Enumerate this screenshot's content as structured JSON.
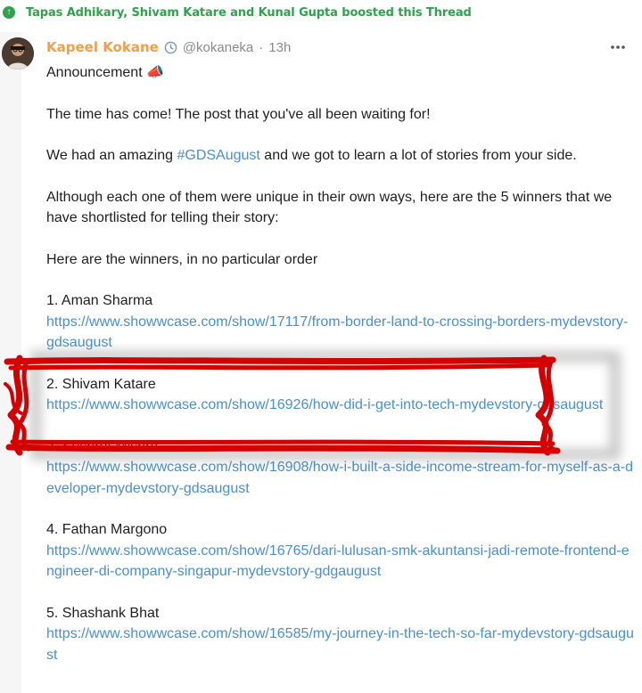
{
  "boost": {
    "icon": "boost-arrow-icon",
    "text": "Tapas Adhikary, Shivam Katare and Kunal Gupta boosted this Thread"
  },
  "post": {
    "author": "Kapeel Kokane",
    "handle": "@kokaneka",
    "separator": "·",
    "time": "13h",
    "accent": "#f0a048",
    "link_color": "#4a8fcf",
    "lines": {
      "announcement": "Announcement 📣",
      "intro": "The time has come! The post that you've all been waiting for!",
      "had_pre": "We had an amazing ",
      "hashtag": "#GDSAugust",
      "had_post": " and we got to learn a lot of stories from your side.",
      "although": "Although each one of them were unique in their own ways, here are the 5 winners that we have shortlisted for telling their story:",
      "winners_intro": "Here are the winners, in no particular order"
    },
    "winners": [
      {
        "label": "1. Aman Sharma",
        "url": "https://www.showwcase.com/show/17117/from-border-land-to-crossing-borders-mydevstory-gdsaugust"
      },
      {
        "label": "2. Shivam Katare",
        "url": "https://www.showwcase.com/show/16926/how-did-i-get-into-tech-mydevstory-gdsaugust"
      },
      {
        "label": "3. Sushrut Mishra",
        "url": "https://www.showwcase.com/show/16908/how-i-built-a-side-income-stream-for-myself-as-a-developer-mydevstory-gdsaugust"
      },
      {
        "label": "4. Fathan Margono",
        "url": "https://www.showwcase.com/show/16765/dari-lulusan-smk-akuntansi-jadi-remote-frontend-engineer-di-company-singapur-mydevstory-gdgaugust"
      },
      {
        "label": "5. Shashank Bhat",
        "url": "https://www.showwcase.com/show/16585/my-journey-in-the-tech-so-far-mydevstory-gdsaugust"
      }
    ]
  }
}
